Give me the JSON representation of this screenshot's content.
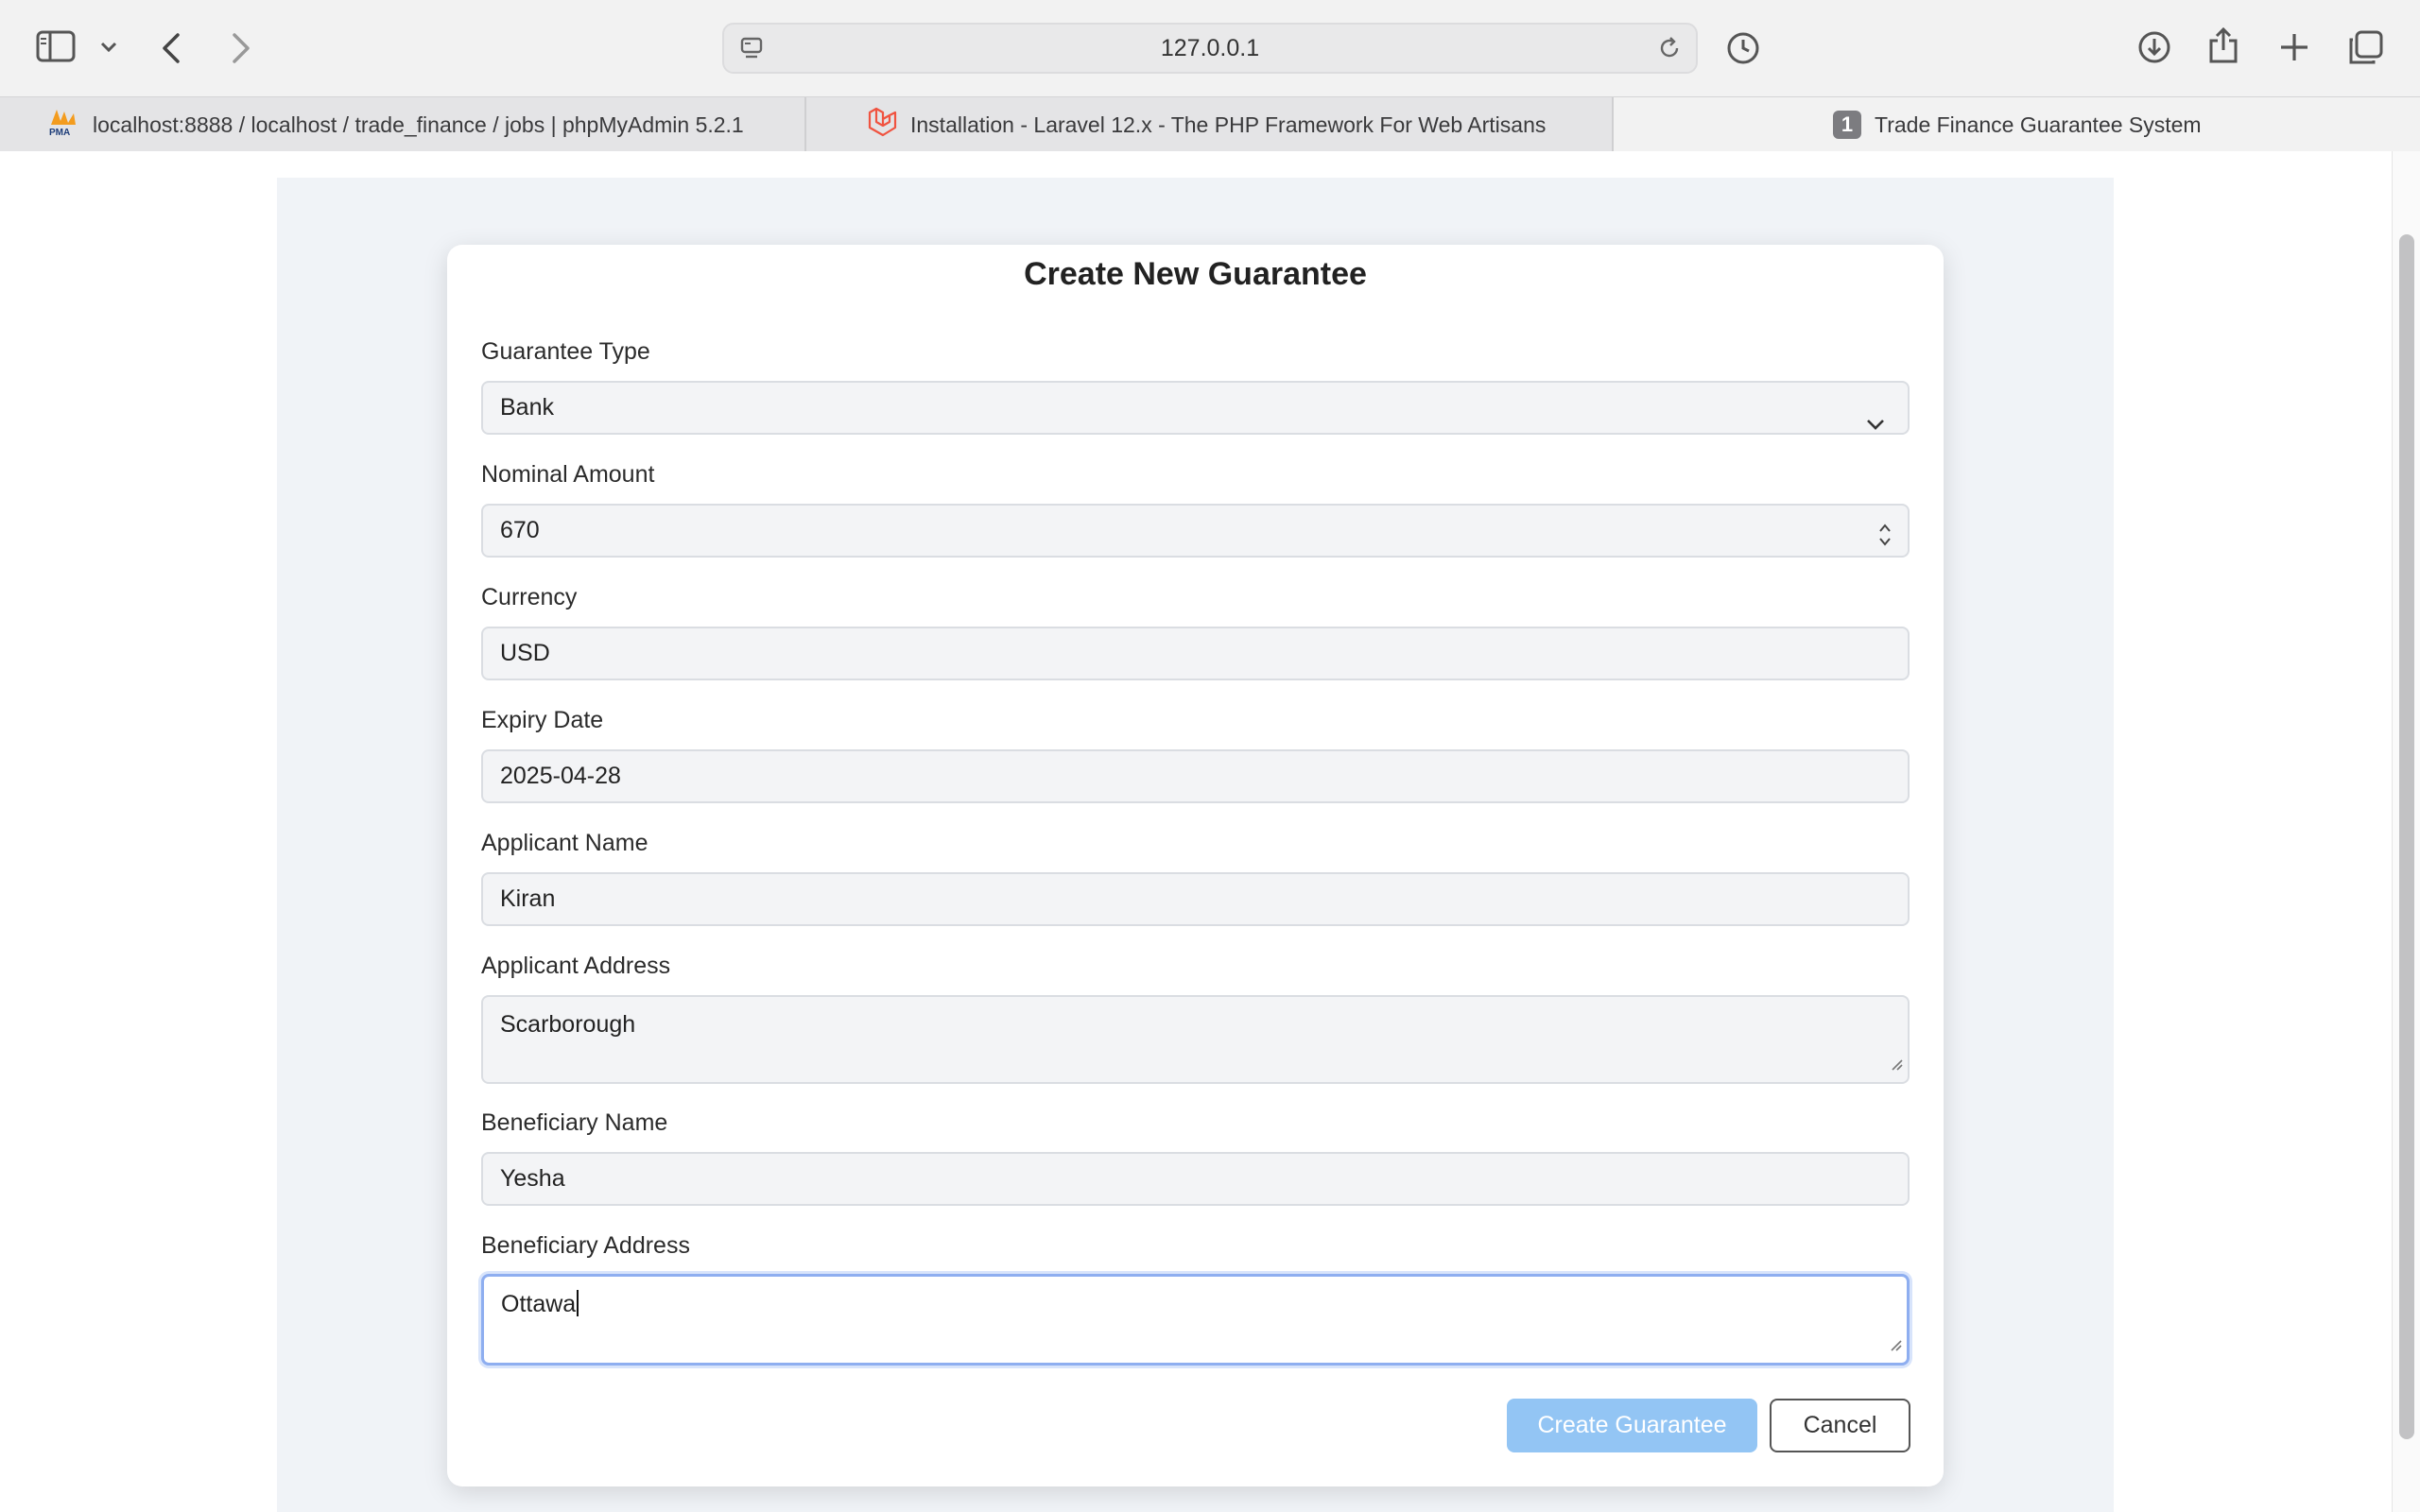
{
  "browser": {
    "url": "127.0.0.1",
    "tabs": [
      {
        "title": "localhost:8888 / localhost / trade_finance / jobs | phpMyAdmin 5.2.1",
        "favicon": "phpmyadmin-logo",
        "favicon_text": "PMA"
      },
      {
        "title": "Installation - Laravel 12.x - The PHP Framework For Web Artisans",
        "favicon": "laravel-logo"
      },
      {
        "title": "Trade Finance Guarantee System",
        "badge": "1",
        "active": true
      }
    ]
  },
  "form": {
    "title": "Create New Guarantee",
    "fields": {
      "guarantee_type": {
        "label": "Guarantee Type",
        "value": "Bank"
      },
      "nominal_amount": {
        "label": "Nominal Amount",
        "value": "670"
      },
      "currency": {
        "label": "Currency",
        "value": "USD"
      },
      "expiry_date": {
        "label": "Expiry Date",
        "value": "2025-04-28"
      },
      "applicant_name": {
        "label": "Applicant Name",
        "value": "Kiran"
      },
      "applicant_address": {
        "label": "Applicant Address",
        "value": "Scarborough"
      },
      "beneficiary_name": {
        "label": "Beneficiary Name",
        "value": "Yesha"
      },
      "beneficiary_address": {
        "label": "Beneficiary Address",
        "value": "Ottawa"
      }
    },
    "buttons": {
      "create": "Create Guarantee",
      "cancel": "Cancel"
    }
  },
  "colors": {
    "primary_button": "#93c5f4",
    "page_background": "#f0f3f7",
    "focus_ring": "#8eaef0"
  }
}
